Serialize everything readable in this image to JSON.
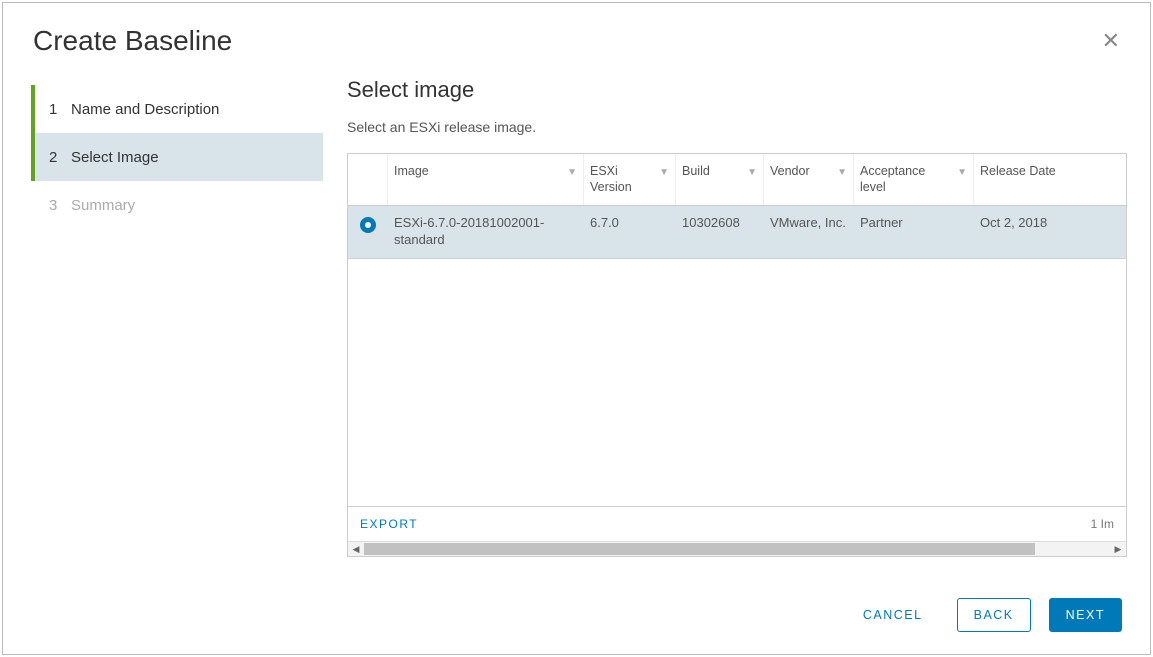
{
  "dialog": {
    "title": "Create Baseline",
    "close_icon": "✕"
  },
  "steps": [
    {
      "num": "1",
      "label": "Name and Description",
      "state": "prev"
    },
    {
      "num": "2",
      "label": "Select Image",
      "state": "current"
    },
    {
      "num": "3",
      "label": "Summary",
      "state": "future"
    }
  ],
  "main": {
    "title": "Select image",
    "subtitle": "Select an ESXi release image."
  },
  "table": {
    "columns": {
      "image": "Image",
      "esxi_version": "ESXi Version",
      "build": "Build",
      "vendor": "Vendor",
      "acceptance_level": "Acceptance level",
      "release_date": "Release Date"
    },
    "rows": [
      {
        "selected": true,
        "image": "ESXi-6.7.0-20181002001-standard",
        "esxi_version": "6.7.0",
        "build": "10302608",
        "vendor": "VMware, Inc.",
        "acceptance_level": "Partner",
        "release_date": "Oct 2, 2018"
      }
    ],
    "export_label": "EXPORT",
    "count_label": "1 Im"
  },
  "footer": {
    "cancel": "CANCEL",
    "back": "BACK",
    "next": "NEXT"
  }
}
